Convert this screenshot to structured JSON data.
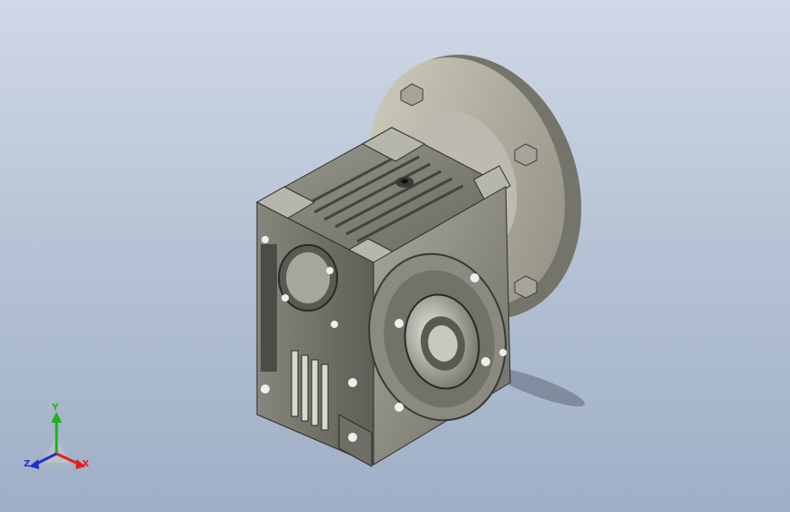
{
  "viewport": {
    "background_top": "#cfd8e6",
    "background_bottom": "#9fafc6",
    "model": "worm-gear-reducer"
  },
  "triad": {
    "x_label": "X",
    "y_label": "Y",
    "z_label": "Z",
    "x_color": "#e02020",
    "y_color": "#20b020",
    "z_color": "#2030d0"
  }
}
